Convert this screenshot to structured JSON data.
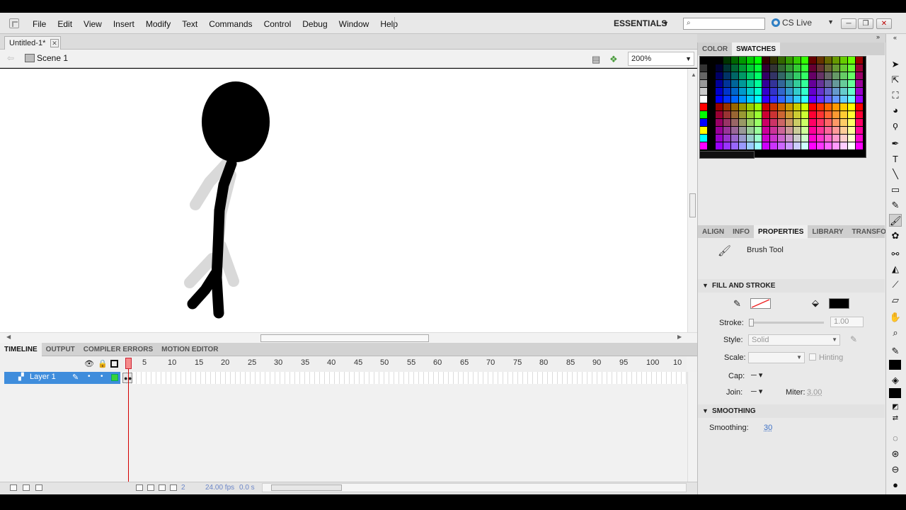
{
  "menu": {
    "items": [
      "File",
      "Edit",
      "View",
      "Insert",
      "Modify",
      "Text",
      "Commands",
      "Control",
      "Debug",
      "Window",
      "Help"
    ],
    "workspace": "ESSENTIALS",
    "search_placeholder": "",
    "cslive": "CS Live"
  },
  "document": {
    "tab": "Untitled-1*",
    "scene": "Scene 1",
    "zoom": "200%"
  },
  "timeline": {
    "tabs": [
      "TIMELINE",
      "OUTPUT",
      "COMPILER ERRORS",
      "MOTION EDITOR"
    ],
    "ruler": [
      "5",
      "10",
      "15",
      "20",
      "25",
      "30",
      "35",
      "40",
      "45",
      "50",
      "55",
      "60",
      "65",
      "70",
      "75",
      "80",
      "85",
      "90",
      "95",
      "100",
      "10"
    ],
    "layer_name": "Layer 1",
    "current_frame": "2",
    "fps": "24.00 fps",
    "time": "0.0 s"
  },
  "color_panel": {
    "tabs": [
      "COLOR",
      "SWATCHES"
    ]
  },
  "properties": {
    "tabs": [
      "ALIGN",
      "INFO",
      "PROPERTIES",
      "LIBRARY",
      "TRANSFO"
    ],
    "tool_name": "Brush Tool",
    "fill_stroke_header": "FILL AND STROKE",
    "stroke_label": "Stroke:",
    "stroke_value": "1.00",
    "style_label": "Style:",
    "style_value": "Solid",
    "scale_label": "Scale:",
    "hinting_label": "Hinting",
    "cap_label": "Cap:",
    "join_label": "Join:",
    "miter_label": "Miter:",
    "miter_value": "3.00",
    "smoothing_header": "SMOOTHING",
    "smoothing_label": "Smoothing:",
    "smoothing_value": "30",
    "fill_color": "#000000"
  },
  "icons": [
    "selection-icon",
    "subselection-icon",
    "free-transform-icon",
    "3d-rotation-icon",
    "lasso-icon",
    "pen-icon",
    "text-icon",
    "line-icon",
    "rectangle-icon",
    "pencil-icon",
    "brush-icon",
    "deco-icon",
    "bone-icon",
    "paint-bucket-icon",
    "eyedropper-icon",
    "eraser-icon",
    "hand-icon",
    "zoom-icon"
  ]
}
